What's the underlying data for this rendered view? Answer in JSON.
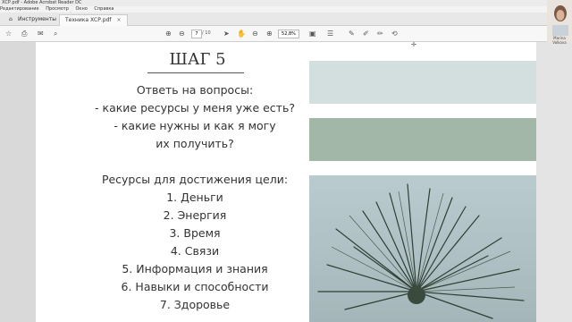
{
  "window_title": "ХСР.pdf - Adobe Acrobat Reader DC",
  "menu": [
    "Редактирование",
    "Просмотр",
    "Окно",
    "Справка"
  ],
  "tabs": [
    {
      "label": "Инструменты",
      "active": false
    },
    {
      "label": "Техника ХСР.pdf",
      "active": true
    }
  ],
  "toolbar": {
    "page_current": "7",
    "page_total": "/ 10",
    "zoom": "52,8%"
  },
  "document": {
    "heading": "ШАГ 5",
    "lines": [
      "Ответь на вопросы:",
      "- какие ресурсы у меня уже есть?",
      "- какие нужны и как я могу",
      "их получить?",
      "",
      "Ресурсы для достижения цели:",
      "1. Деньги",
      "2. Энергия",
      "3. Время",
      "4. Связи",
      "5. Информация и знания",
      "6. Навыки и способности",
      "7. Здоровье"
    ],
    "colors": {
      "swatch_light": "#d3dfde",
      "swatch_sage": "#a3b7a9"
    }
  },
  "webcam": {
    "name": "Marina Volkova"
  },
  "icons": [
    "home-icon",
    "print-icon",
    "mail-icon",
    "search-icon",
    "up-icon",
    "down-icon",
    "cursor-icon",
    "hand-icon",
    "zoom-out-icon",
    "zoom-in-icon",
    "fit-icon",
    "sign-icon",
    "comment-icon",
    "pen-icon",
    "highlight-icon",
    "share-icon"
  ]
}
